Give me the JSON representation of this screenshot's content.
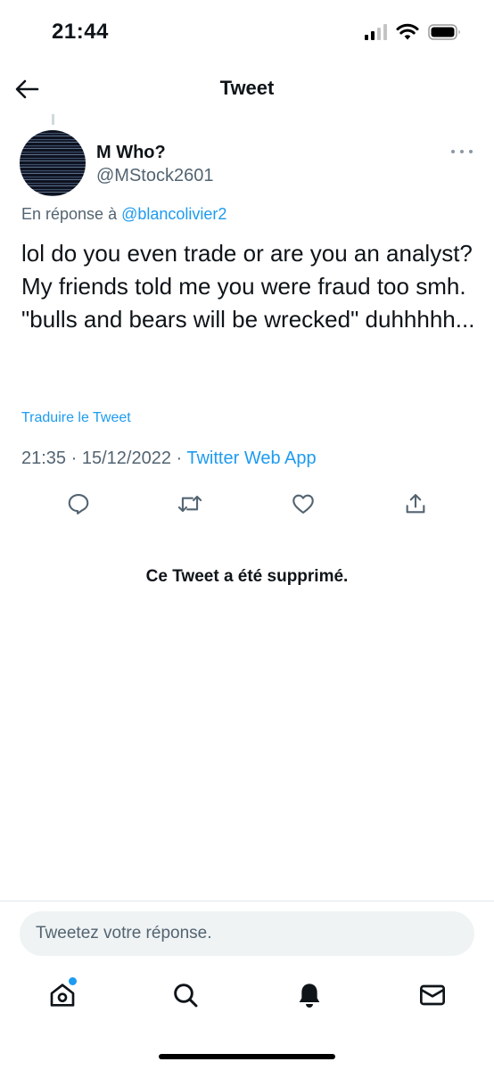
{
  "status_bar": {
    "time": "21:44"
  },
  "header": {
    "title": "Tweet"
  },
  "tweet": {
    "author_name": "M Who?",
    "author_handle": "@MStock2601",
    "reply_prefix": "En réponse à ",
    "reply_handle": "@blancolivier2",
    "text": "lol do you even trade or are you an analyst? My friends told me you were fraud too smh. \"bulls and bears will be wrecked\" duhhhhh...",
    "translate_label": "Traduire le Tweet",
    "time": "21:35",
    "separator": " · ",
    "date": "15/12/2022",
    "source": "Twitter Web App"
  },
  "actions": [
    "reply-icon",
    "retweet-icon",
    "like-icon",
    "share-icon"
  ],
  "deleted_notice": "Ce Tweet a été supprimé.",
  "reply_box": {
    "placeholder": "Tweetez votre réponse."
  },
  "tabbar": [
    "home-icon",
    "search-icon",
    "notifications-icon",
    "messages-icon"
  ],
  "colors": {
    "accent": "#1d9bf0",
    "secondary_text": "#536471",
    "primary_text": "#0f1419",
    "input_bg": "#eff3f4"
  }
}
